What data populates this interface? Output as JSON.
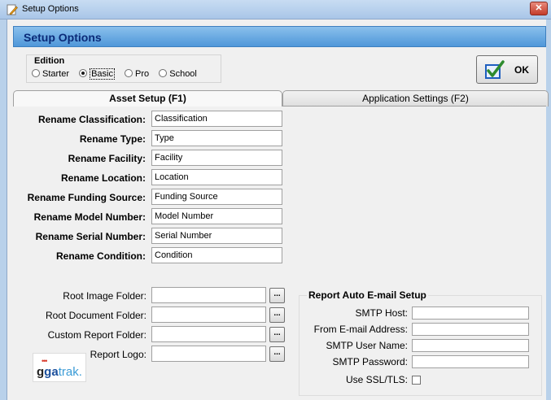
{
  "window": {
    "title": "Setup Options"
  },
  "header": {
    "title": "Setup Options"
  },
  "edition": {
    "legend": "Edition",
    "options": [
      {
        "label": "Starter",
        "selected": false
      },
      {
        "label": "Basic",
        "selected": true
      },
      {
        "label": "Pro",
        "selected": false
      },
      {
        "label": "School",
        "selected": false
      }
    ]
  },
  "ok_button": {
    "label": "OK"
  },
  "tabs": [
    {
      "label": "Asset Setup (F1)",
      "active": true
    },
    {
      "label": "Application Settings (F2)",
      "active": false
    }
  ],
  "rename_fields": [
    {
      "label": "Rename Classification:",
      "value": "Classification"
    },
    {
      "label": "Rename Type:",
      "value": "Type"
    },
    {
      "label": "Rename Facility:",
      "value": "Facility"
    },
    {
      "label": "Rename Location:",
      "value": "Location"
    },
    {
      "label": "Rename Funding Source:",
      "value": "Funding Source"
    },
    {
      "label": "Rename Model Number:",
      "value": "Model Number"
    },
    {
      "label": "Rename Serial Number:",
      "value": "Serial Number"
    },
    {
      "label": "Rename Condition:",
      "value": "Condition"
    }
  ],
  "folder_fields": [
    {
      "label": "Root Image Folder:",
      "value": "",
      "button": "..."
    },
    {
      "label": "Root Document Folder:",
      "value": "",
      "button": "..."
    },
    {
      "label": "Custom Report Folder:",
      "value": "",
      "button": "..."
    },
    {
      "label": "Report Logo:",
      "value": "",
      "button": "..."
    }
  ],
  "logo": {
    "text_part1": "g",
    "text_part2": "ga",
    "text_part3": "trak.",
    "dots": "•••"
  },
  "email_setup": {
    "legend": "Report Auto E-mail Setup",
    "fields": [
      {
        "label": "SMTP Host:",
        "value": ""
      },
      {
        "label": "From E-mail Address:",
        "value": ""
      },
      {
        "label": "SMTP User Name:",
        "value": ""
      },
      {
        "label": "SMTP Password:",
        "value": ""
      }
    ],
    "ssl_label": "Use SSL/TLS:",
    "ssl_checked": false
  },
  "colors": {
    "header_gradient_top": "#8ac0ec",
    "header_gradient_bottom": "#4f97d9",
    "header_text": "#0a2a78",
    "close_button": "#c43c2a",
    "ok_check": "#2e8b2e",
    "ok_box": "#1f5fbf"
  },
  "icons": {
    "app": "pencil-icon",
    "close": "close-icon",
    "ok": "checkmark-icon"
  }
}
